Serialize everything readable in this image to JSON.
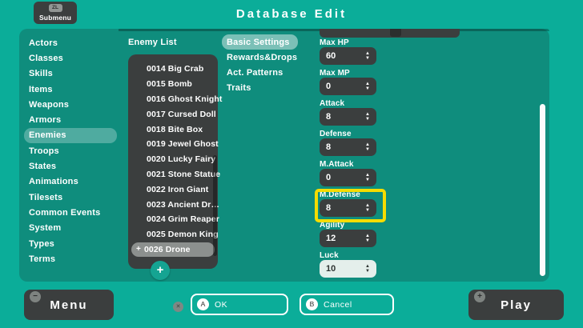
{
  "title": "Database Edit",
  "submenu": {
    "shortcut": "ZL",
    "label": "Submenu"
  },
  "icons": {
    "up": "▲",
    "down": "▼",
    "plus": "+",
    "minus": "−",
    "close": "✕"
  },
  "sidebar": {
    "items": [
      "Actors",
      "Classes",
      "Skills",
      "Items",
      "Weapons",
      "Armors",
      "Enemies",
      "Troops",
      "States",
      "Animations",
      "Tilesets",
      "Common Events",
      "System",
      "Types",
      "Terms"
    ],
    "selected": "Enemies"
  },
  "enemy_list": {
    "title": "Enemy List",
    "items": [
      "0014 Big Crab",
      "0015 Bomb",
      "0016 Ghost Knight",
      "0017 Cursed Doll",
      "0018 Bite Box",
      "0019 Jewel Ghost",
      "0020 Lucky Fairy",
      "0021 Stone Statue",
      "0022 Iron Giant",
      "0023 Ancient Dr…",
      "0024 Grim Reaper",
      "0025 Demon King",
      "0026 Drone"
    ],
    "selected": "0026 Drone"
  },
  "tabs": {
    "items": [
      "Basic Settings",
      "Rewards&Drops",
      "Act. Patterns",
      "Traits"
    ],
    "selected": "Basic Settings"
  },
  "settings": {
    "fields": [
      {
        "label": "Max HP",
        "value": "60"
      },
      {
        "label": "Max MP",
        "value": "0"
      },
      {
        "label": "Attack",
        "value": "8"
      },
      {
        "label": "Defense",
        "value": "8"
      },
      {
        "label": "M.Attack",
        "value": "0"
      },
      {
        "label": "M.Defense",
        "value": "8",
        "highlighted": true
      },
      {
        "label": "Agility",
        "value": "12"
      },
      {
        "label": "Luck",
        "value": "10",
        "focused": true
      }
    ]
  },
  "bottom_bar": {
    "menu": {
      "label": "Menu",
      "badge": "−"
    },
    "x_hint": "✕",
    "ok": {
      "button": "A",
      "label": "OK"
    },
    "cancel": {
      "button": "B",
      "label": "Cancel"
    },
    "play": {
      "label": "Play",
      "badge": "+"
    }
  },
  "colors": {
    "background": "#0BAD99",
    "panel": "#0F8D7D",
    "dark_element": "#3B3E3E",
    "highlight_yellow": "#F6DC00",
    "selected_row_gray": "#8C908E",
    "focused_field_light": "#E4EFEB",
    "accent_teal": "#15A492"
  }
}
